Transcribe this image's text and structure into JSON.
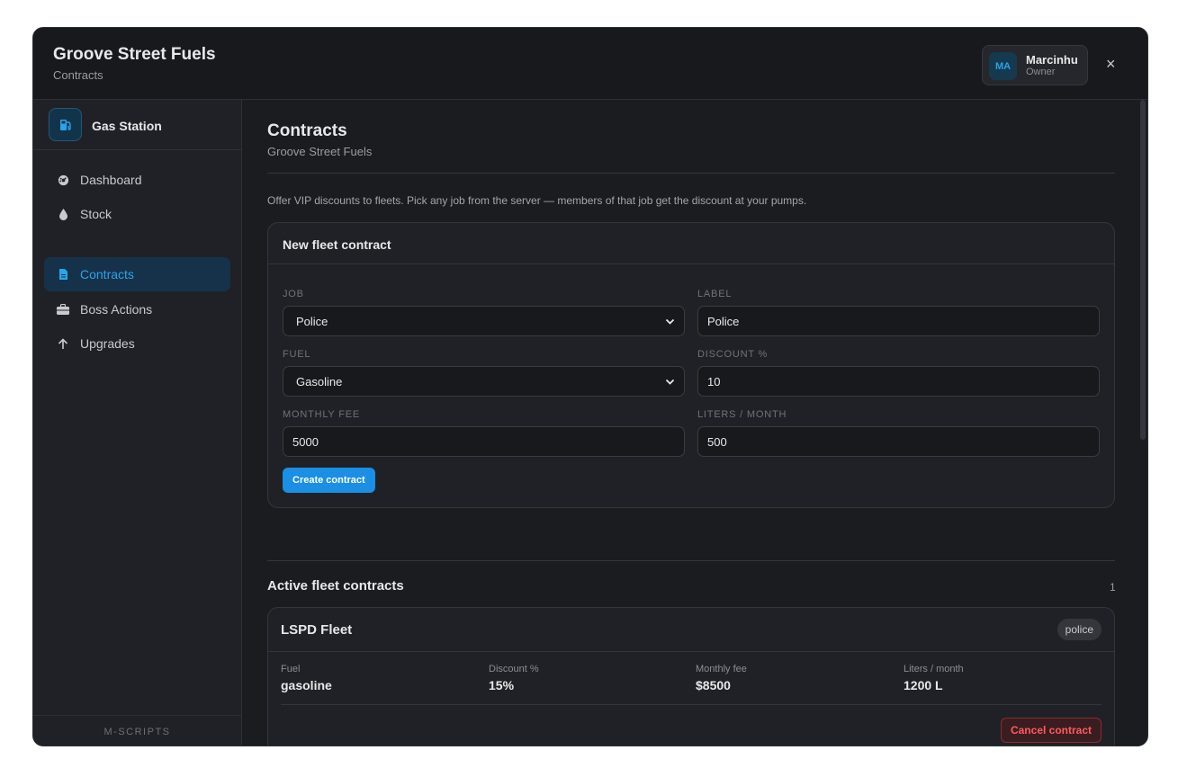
{
  "header": {
    "title": "Groove Street Fuels",
    "subtitle": "Contracts"
  },
  "user": {
    "initials": "MA",
    "name": "Marcinhu",
    "role": "Owner"
  },
  "close_label": "×",
  "sidebar": {
    "brand": "Gas Station",
    "items": [
      {
        "label": "Dashboard",
        "icon": "dashboard-icon",
        "active": false
      },
      {
        "label": "Stock",
        "icon": "droplet-icon",
        "active": false
      },
      {
        "label": "Contracts",
        "icon": "document-icon",
        "active": true
      },
      {
        "label": "Boss Actions",
        "icon": "briefcase-icon",
        "active": false
      },
      {
        "label": "Upgrades",
        "icon": "arrow-up-icon",
        "active": false
      }
    ],
    "footer": "M-SCRIPTS"
  },
  "main": {
    "title": "Contracts",
    "subtitle": "Groove Street Fuels",
    "description": "Offer VIP discounts to fleets. Pick any job from the server — members of that job get the discount at your pumps."
  },
  "form": {
    "title": "New fleet contract",
    "job_label": "JOB",
    "job_value": "Police",
    "label_label": "LABEL",
    "label_value": "Police",
    "fuel_label": "FUEL",
    "fuel_value": "Gasoline",
    "discount_label": "DISCOUNT %",
    "discount_value": "10",
    "fee_label": "MONTHLY FEE",
    "fee_value": "5000",
    "liters_label": "LITERS / MONTH",
    "liters_value": "500",
    "submit": "Create contract"
  },
  "active": {
    "title": "Active fleet contracts",
    "count": "1",
    "contracts": [
      {
        "name": "LSPD Fleet",
        "tag": "police",
        "fuel_label": "Fuel",
        "fuel": "gasoline",
        "discount_label": "Discount %",
        "discount": "15%",
        "fee_label": "Monthly fee",
        "fee": "$8500",
        "liters_label": "Liters / month",
        "liters": "1200 L",
        "cancel": "Cancel contract"
      }
    ]
  },
  "colors": {
    "accent": "#1a8fe3",
    "danger": "#ff5a5f",
    "background": "#1b1c20"
  }
}
